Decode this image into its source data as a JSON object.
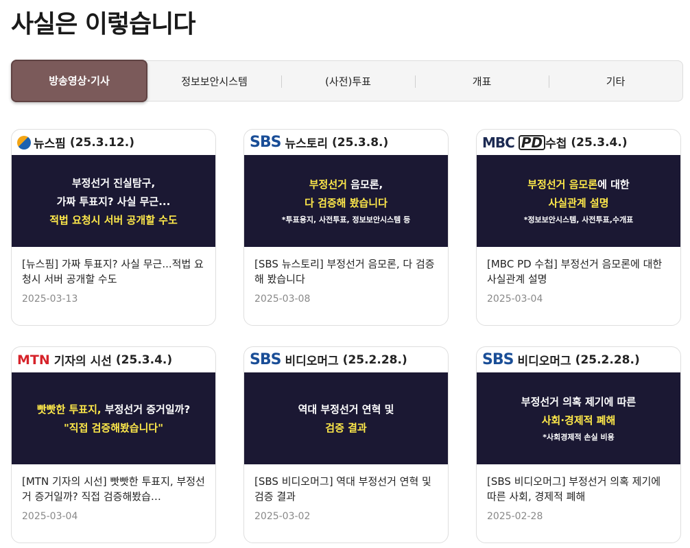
{
  "page": {
    "title": "사실은 이렇습니다"
  },
  "tabs": [
    {
      "label": "방송영상·기사",
      "active": true
    },
    {
      "label": "정보보안시스템",
      "active": false
    },
    {
      "label": "(사전)투표",
      "active": false
    },
    {
      "label": "개표",
      "active": false
    },
    {
      "label": "기타",
      "active": false
    }
  ],
  "cards": [
    {
      "source_logo": "뉴스핌",
      "source_date": "(25.3.12.)",
      "thumb": {
        "line1": "부정선거 진실탐구,",
        "line2": "가짜 투표지? 사실 무근...",
        "line3": "적법 요청시 서버 공개할 수도"
      },
      "title": "[뉴스핌] 가짜 투표지? 사실 무근...적법 요청시 서버 공개할 수도",
      "date": "2025-03-13"
    },
    {
      "source_logo": "SBS",
      "source_name": "뉴스토리",
      "source_date": "(25.3.8.)",
      "thumb": {
        "line1a": "부정선거",
        "line1b": " 음모론,",
        "line2": "다 검증해 봤습니다",
        "line3": "*투표용지, 사전투표, 정보보안시스템 등"
      },
      "title": "[SBS 뉴스토리] 부정선거 음모론, 다 검증해 봤습니다",
      "date": "2025-03-08"
    },
    {
      "source_logo": "MBC",
      "source_logo2": "PD",
      "source_name": "수첩",
      "source_date": "(25.3.4.)",
      "thumb": {
        "line1a": "부정선거 음모론",
        "line1b": "에 대한",
        "line2": "사실관계 설명",
        "line3": "*정보보안시스템, 사전투표,수개표"
      },
      "title": "[MBC PD 수첩] 부정선거 음모론에 대한 사실관계 설명",
      "date": "2025-03-04"
    },
    {
      "source_logo": "MTN",
      "source_name": "기자의 시선",
      "source_date": "(25.3.4.)",
      "thumb": {
        "line1a": "빳빳한 투표지,",
        "line1b": " 부정선거 증거일까?",
        "line2": "\"직접 검증해봤습니다\""
      },
      "title": "[MTN 기자의 시선] 빳빳한 투표지, 부정선거 증거일까? 직접 검증해봤습…",
      "date": "2025-03-04"
    },
    {
      "source_logo": "SBS",
      "source_name": "비디오머그",
      "source_date": "(25.2.28.)",
      "thumb": {
        "line1": "역대 부정선거 연혁 및",
        "line2": "검증 결과"
      },
      "title": "[SBS 비디오머그] 역대 부정선거 연혁 및 검증 결과",
      "date": "2025-03-02"
    },
    {
      "source_logo": "SBS",
      "source_name": "비디오머그",
      "source_date": "(25.2.28.)",
      "thumb": {
        "line1": "부정선거 의혹 제기에 따른",
        "line2": "사회·경제적 폐해",
        "line3": "*사회경제적 손실 비용"
      },
      "title": "[SBS 비디오머그] 부정선거 의혹 제기에 따른 사회, 경제적 폐해",
      "date": "2025-02-28"
    }
  ]
}
